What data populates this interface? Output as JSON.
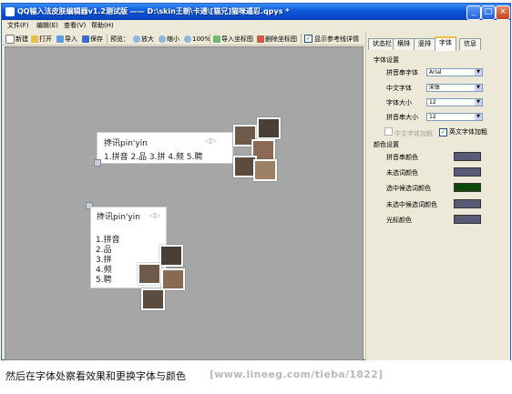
{
  "window": {
    "title": "QQ输入法皮肤编辑器v1.2测试版 —— D:\\skin王朝\\卡通\\[猫兄]猫咪遁忍.qpys *",
    "controls": {
      "minimize": "_",
      "maximize": "□",
      "close": "×"
    }
  },
  "menu": [
    "文件(F)",
    "编辑(E)",
    "查看(V)",
    "帮助(H)"
  ],
  "toolbar": {
    "new": "新建",
    "open": "打开",
    "import": "导入",
    "save": "保存",
    "preview_label": "预览：",
    "zoom_in": "放大",
    "zoom_out": "缩小",
    "zoom_100": "100%",
    "import_coords": "导入坐标图",
    "delete_coords": "删除坐标图",
    "show_ref_lines": "显示参考线详情"
  },
  "preview": {
    "horizontal": {
      "composition": "搀讯pin'yin",
      "candidates": "1.拼音 2.品 3.拼 4.频 5.聘"
    },
    "vertical": {
      "composition": "搀讯pin'yin",
      "candidates": [
        "1.拼音",
        "2.品",
        "3.拼",
        "4.频",
        "5.聘"
      ]
    }
  },
  "panel": {
    "tabs": [
      "状态栏",
      "横排",
      "竖排",
      "字体",
      "信息"
    ],
    "active_tab": "字体",
    "font_section": "字体设置",
    "fields": [
      {
        "label": "拼音串字体",
        "value": "Arial"
      },
      {
        "label": "中文字体",
        "value": "宋体"
      },
      {
        "label": "字体大小",
        "value": "12"
      },
      {
        "label": "拼音串大小",
        "value": "12"
      }
    ],
    "bold_cn": "中文字体加粗",
    "bold_en": "英文字体加粗",
    "color_section": "颜色设置",
    "colors": [
      {
        "label": "拼音串颜色",
        "hex": "#5a5a78"
      },
      {
        "label": "未选词颜色",
        "hex": "#5a5a78"
      },
      {
        "label": "选中候选词颜色",
        "hex": "#0b4a0b"
      },
      {
        "label": "未选中候选词颜色",
        "hex": "#5a5a78"
      },
      {
        "label": "光标颜色",
        "hex": "#5a5a78"
      }
    ]
  },
  "caption": "然后在字体处察看效果和更换字体与颜色",
  "watermark": "[www.lineeg.com/tieba/1822]"
}
